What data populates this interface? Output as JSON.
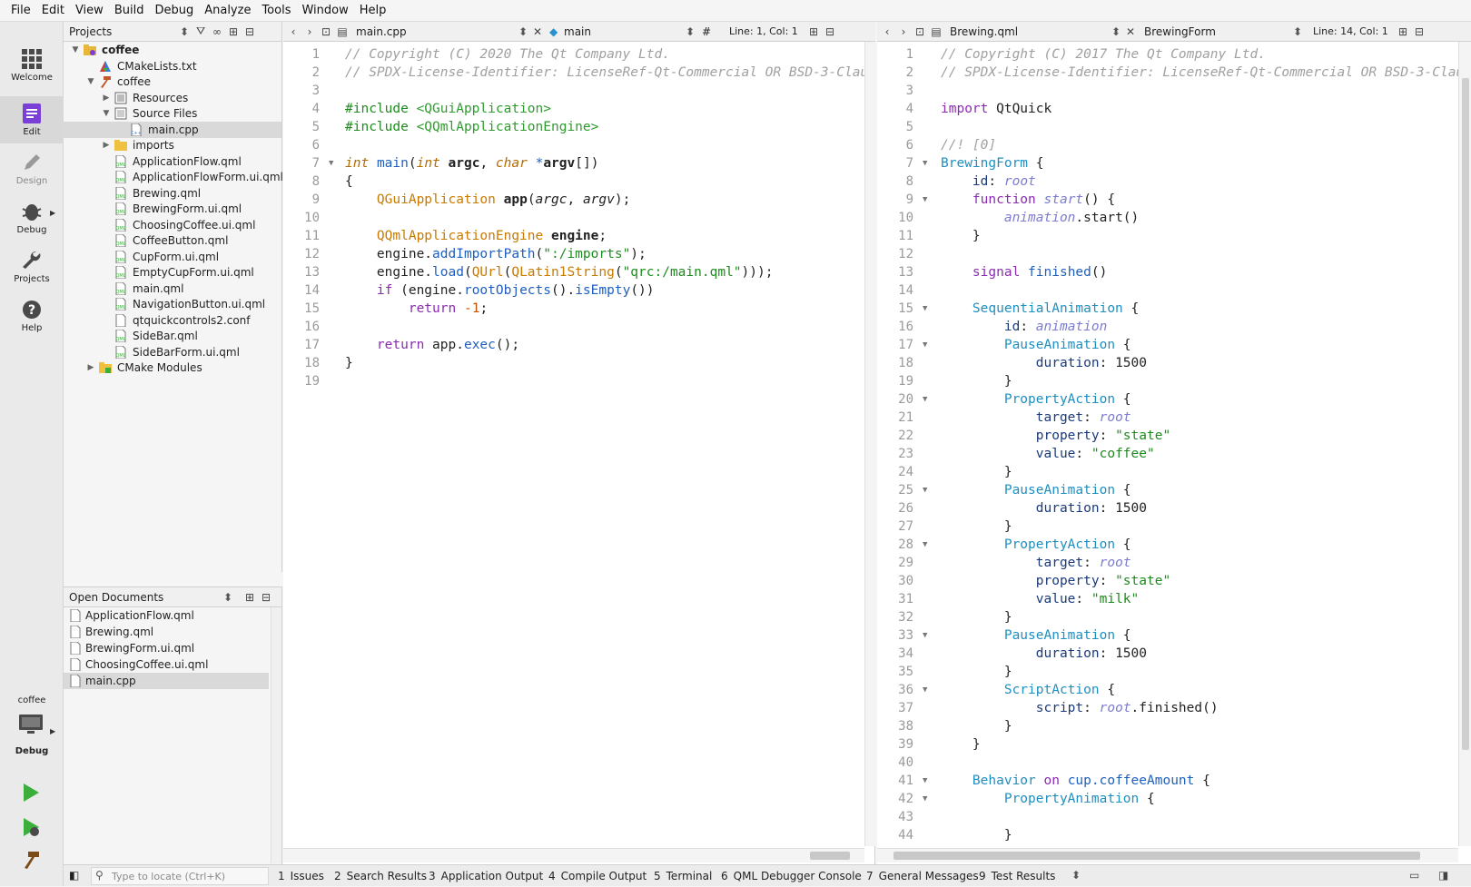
{
  "menubar": {
    "items": [
      {
        "label": "File",
        "ul": "F"
      },
      {
        "label": "Edit",
        "ul": "E"
      },
      {
        "label": "View",
        "ul": "V"
      },
      {
        "label": "Build",
        "ul": "B"
      },
      {
        "label": "Debug",
        "ul": "D"
      },
      {
        "label": "Analyze",
        "ul": "A"
      },
      {
        "label": "Tools",
        "ul": "T"
      },
      {
        "label": "Window",
        "ul": "W"
      },
      {
        "label": "Help",
        "ul": "H"
      }
    ]
  },
  "modebar": {
    "modes": [
      "Welcome",
      "Edit",
      "Design",
      "Debug",
      "Projects",
      "Help"
    ],
    "active": "Edit",
    "kit_project": "coffee",
    "kit_build": "Debug"
  },
  "projects": {
    "title": "Projects",
    "tree": [
      {
        "label": "coffee",
        "depth": 0,
        "expanded": true,
        "icon": "project-icon",
        "bold": true
      },
      {
        "label": "CMakeLists.txt",
        "depth": 1,
        "icon": "cmake-file-icon"
      },
      {
        "label": "coffee",
        "depth": 1,
        "expanded": true,
        "icon": "hammer-icon"
      },
      {
        "label": "Resources",
        "depth": 2,
        "expanded": false,
        "icon": "resources-icon"
      },
      {
        "label": "Source Files",
        "depth": 2,
        "expanded": true,
        "icon": "source-files-icon"
      },
      {
        "label": "main.cpp",
        "depth": 3,
        "icon": "cpp-file-icon",
        "selected": true
      },
      {
        "label": "imports",
        "depth": 2,
        "expanded": false,
        "icon": "folder-icon"
      },
      {
        "label": "ApplicationFlow.qml",
        "depth": 2,
        "icon": "qml-file-icon"
      },
      {
        "label": "ApplicationFlowForm.ui.qml",
        "depth": 2,
        "icon": "qml-file-icon"
      },
      {
        "label": "Brewing.qml",
        "depth": 2,
        "icon": "qml-file-icon"
      },
      {
        "label": "BrewingForm.ui.qml",
        "depth": 2,
        "icon": "qml-file-icon"
      },
      {
        "label": "ChoosingCoffee.ui.qml",
        "depth": 2,
        "icon": "qml-file-icon"
      },
      {
        "label": "CoffeeButton.qml",
        "depth": 2,
        "icon": "qml-file-icon"
      },
      {
        "label": "CupForm.ui.qml",
        "depth": 2,
        "icon": "qml-file-icon"
      },
      {
        "label": "EmptyCupForm.ui.qml",
        "depth": 2,
        "icon": "qml-file-icon"
      },
      {
        "label": "main.qml",
        "depth": 2,
        "icon": "qml-file-icon"
      },
      {
        "label": "NavigationButton.ui.qml",
        "depth": 2,
        "icon": "qml-file-icon"
      },
      {
        "label": "qtquickcontrols2.conf",
        "depth": 2,
        "icon": "text-file-icon"
      },
      {
        "label": "SideBar.qml",
        "depth": 2,
        "icon": "qml-file-icon"
      },
      {
        "label": "SideBarForm.ui.qml",
        "depth": 2,
        "icon": "qml-file-icon"
      },
      {
        "label": "CMake Modules",
        "depth": 1,
        "expanded": false,
        "icon": "cmake-modules-icon"
      }
    ]
  },
  "open_documents": {
    "title": "Open Documents",
    "items": [
      "ApplicationFlow.qml",
      "Brewing.qml",
      "BrewingForm.ui.qml",
      "ChoosingCoffee.ui.qml",
      "main.cpp"
    ],
    "selected": "main.cpp"
  },
  "left_editor": {
    "file": "main.cpp",
    "symbol": "main",
    "hash": "#",
    "position": "Line: 1, Col: 1"
  },
  "right_editor": {
    "file": "Brewing.qml",
    "symbol": "BrewingForm",
    "position": "Line: 14, Col: 1"
  },
  "statusbar": {
    "locator_placeholder": "Type to locate (Ctrl+K)",
    "panes": [
      {
        "num": "1",
        "label": "Issues"
      },
      {
        "num": "2",
        "label": "Search Results"
      },
      {
        "num": "3",
        "label": "Application Output"
      },
      {
        "num": "4",
        "label": "Compile Output"
      },
      {
        "num": "5",
        "label": "Terminal"
      },
      {
        "num": "6",
        "label": "QML Debugger Console"
      },
      {
        "num": "7",
        "label": "General Messages"
      },
      {
        "num": "9",
        "label": "Test Results"
      }
    ]
  },
  "colors": {
    "accent": "#7a3fd6",
    "run_green": "#3cae3c",
    "selection": "#d9d9d9"
  }
}
